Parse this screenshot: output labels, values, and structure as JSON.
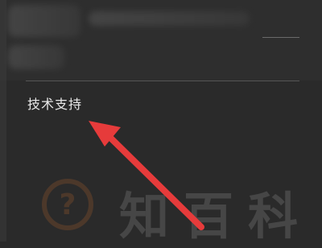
{
  "menu": {
    "item_label": "技术支持"
  },
  "watermark": {
    "glyph": "?",
    "text": "知百科"
  },
  "colors": {
    "background": "#2a2a2a",
    "text": "#e8e8e8",
    "arrow": "#e63b3b",
    "watermark_accent": "#c56a2a"
  }
}
